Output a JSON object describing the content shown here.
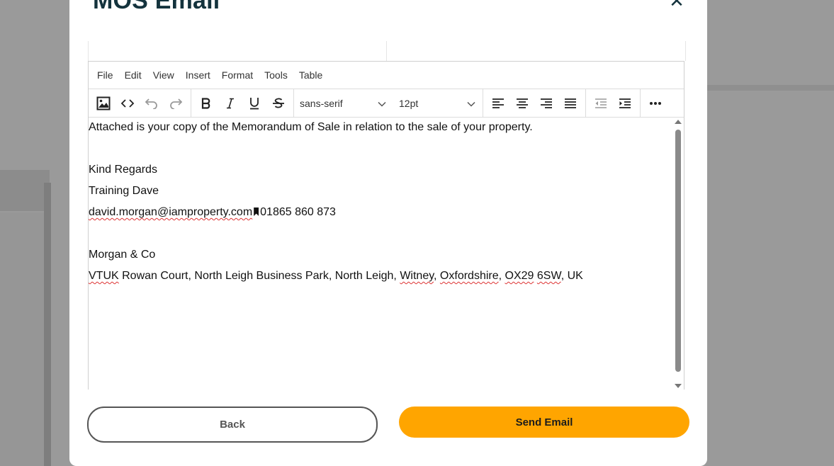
{
  "modal": {
    "title": "MOS Email",
    "close_glyph": "✕"
  },
  "editor": {
    "menubar": [
      "File",
      "Edit",
      "View",
      "Insert",
      "Format",
      "Tools",
      "Table"
    ],
    "toolbar": {
      "font_family": "sans-serif",
      "font_size": "12pt",
      "icons": [
        "image-icon",
        "code-icon",
        "undo-icon",
        "redo-icon",
        "bold-icon",
        "italic-icon",
        "underline-icon",
        "strikethrough-icon",
        "align-left-icon",
        "align-center-icon",
        "align-right-icon",
        "align-justify-icon",
        "outdent-icon",
        "indent-icon",
        "more-icon"
      ]
    },
    "body": {
      "line1": "Attached is your copy of the Memorandum of Sale in relation to the sale of your property.",
      "line2": "Kind Regards",
      "line3": "Training Dave",
      "email": "david.morgan@iamproperty.com",
      "phone": "01865 860 873",
      "company": "Morgan & Co",
      "addr_vtuk": "VTUK",
      "addr_a": " Rowan Court, North Leigh Business Park, North Leigh, ",
      "addr_witney": "Witney",
      "addr_sep1": ", ",
      "addr_oxon": "Oxfordshire",
      "addr_sep2": ", ",
      "addr_ox29": "OX29",
      "addr_sp": " ",
      "addr_6sw": "6SW",
      "addr_end": ", UK"
    }
  },
  "actions": {
    "back_label": "Back",
    "send_label": "Send Email"
  },
  "colors": {
    "send_button": "#ffa500",
    "title": "#14333d"
  }
}
